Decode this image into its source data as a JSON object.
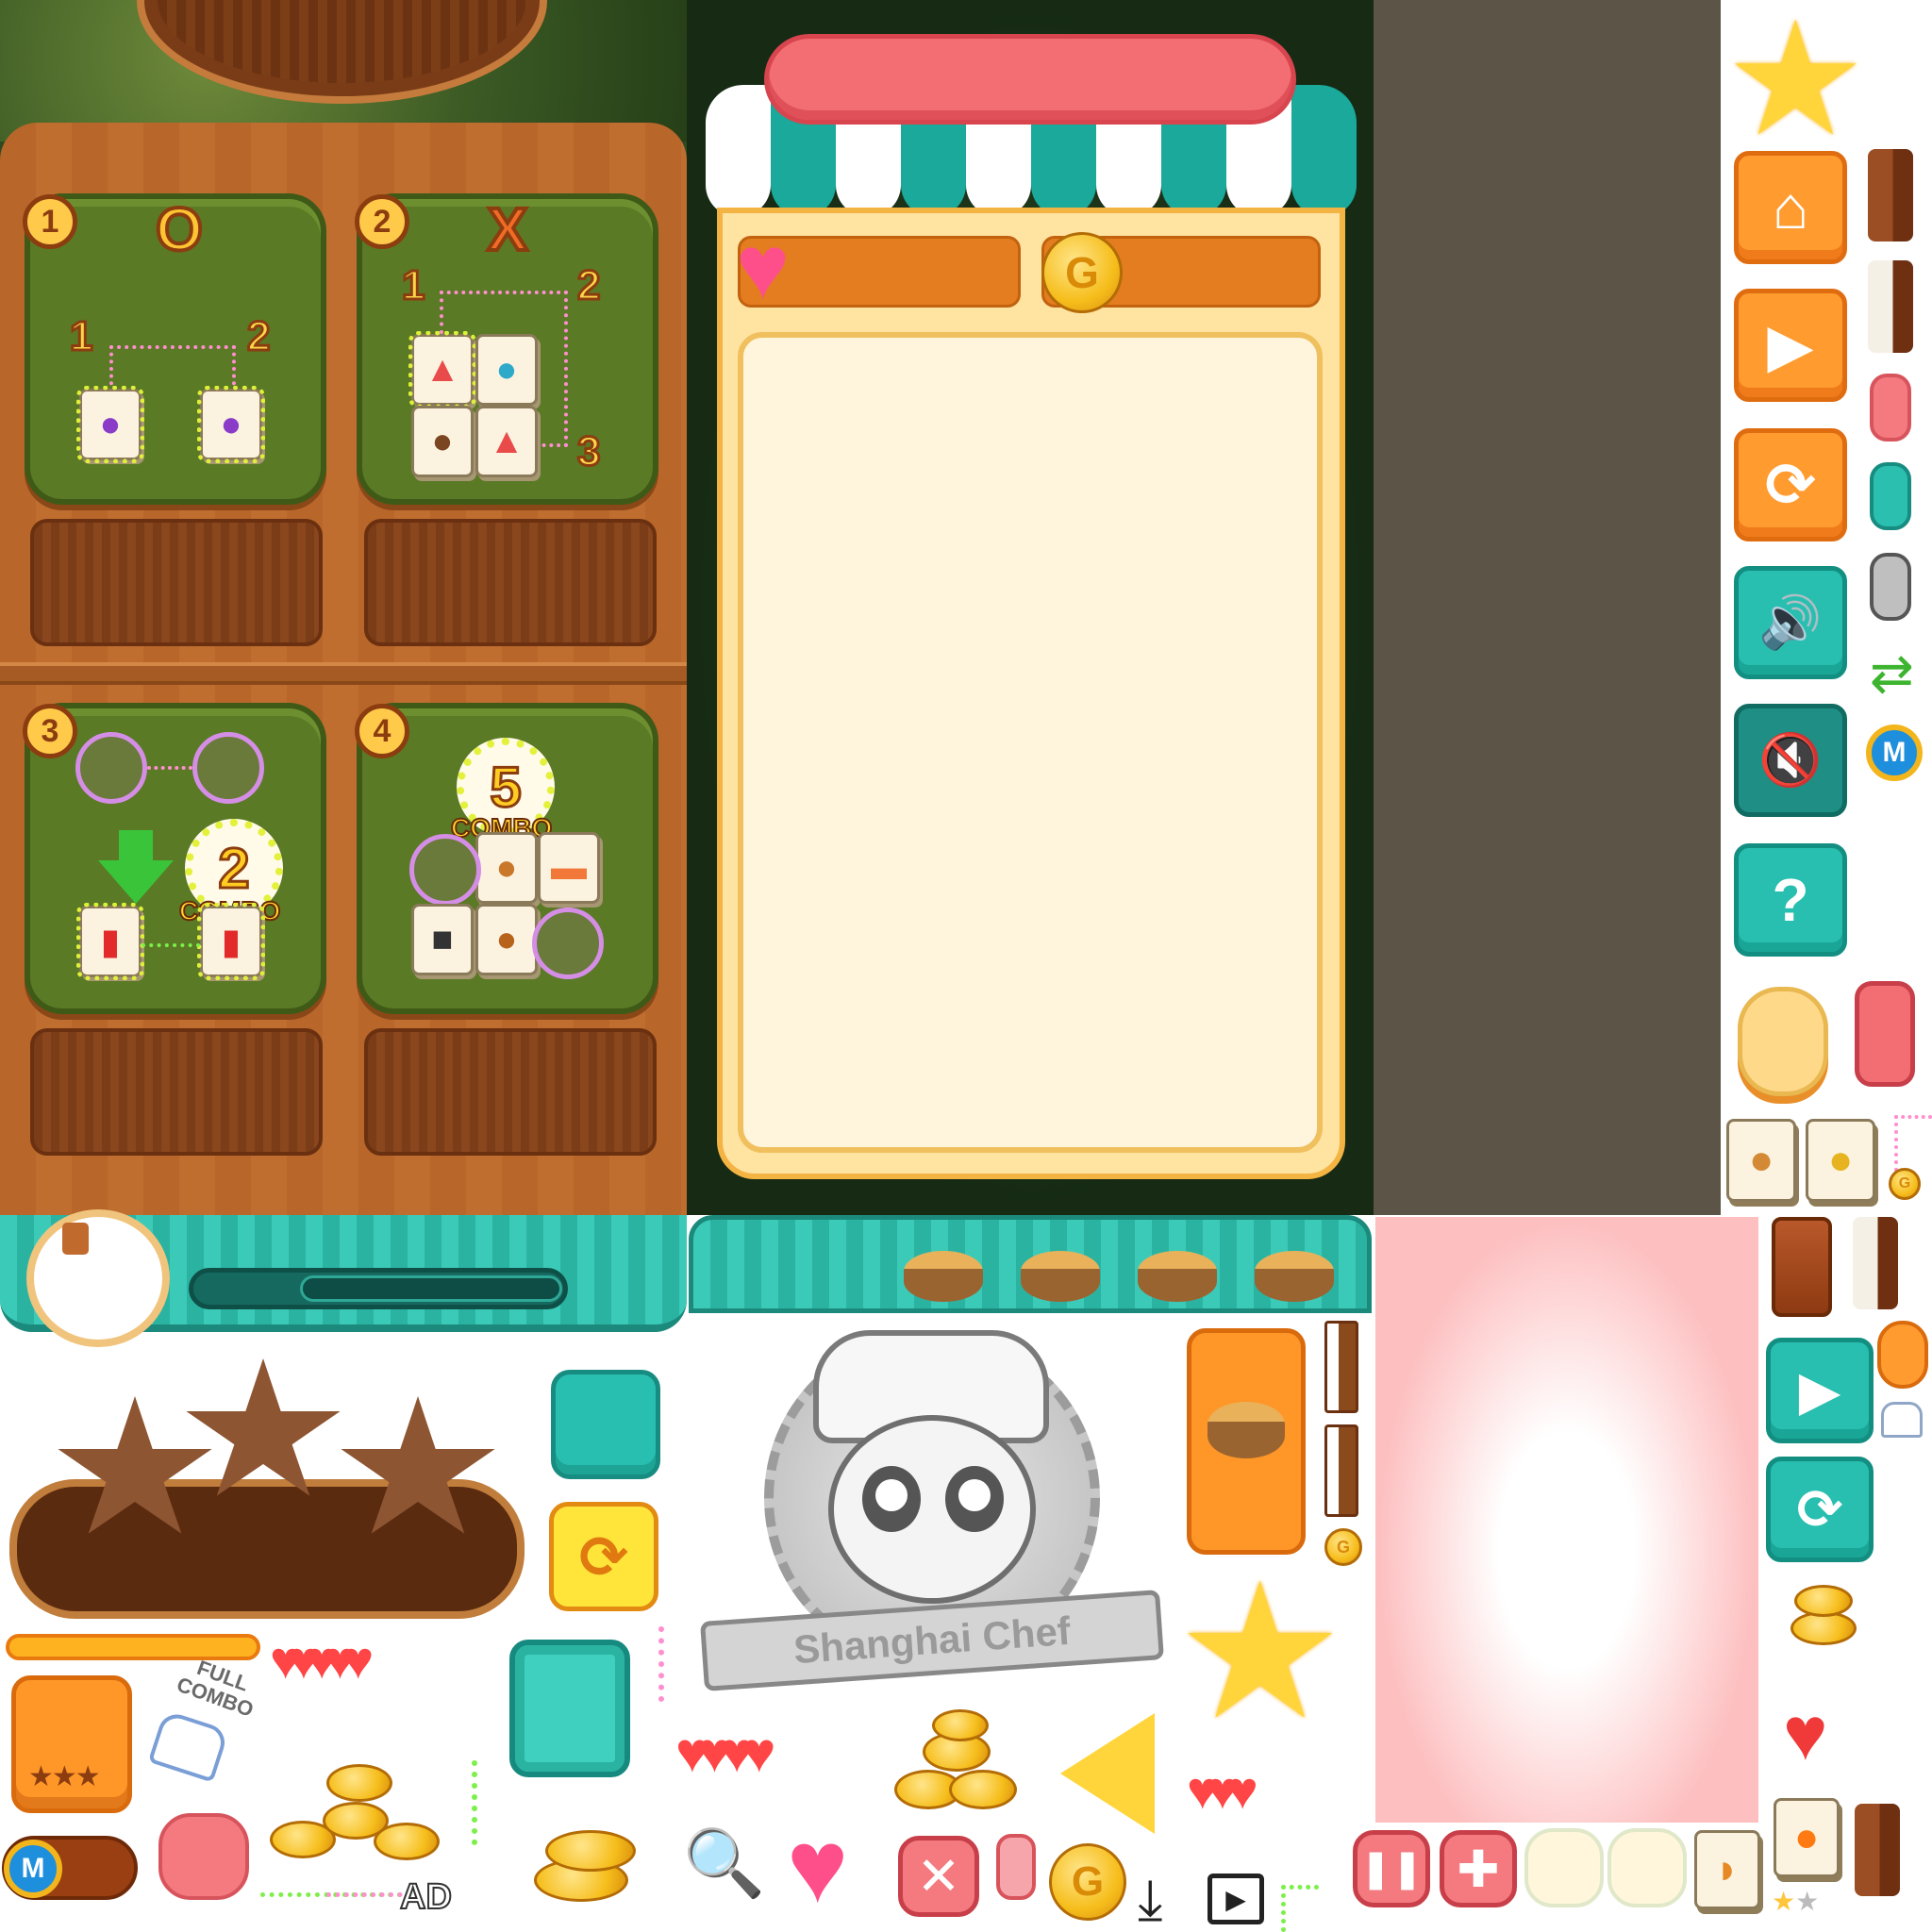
{
  "tutorial": {
    "steps": [
      {
        "badge": "1",
        "mark": "O",
        "labels": [
          "1",
          "2"
        ]
      },
      {
        "badge": "2",
        "mark": "X",
        "labels": [
          "1",
          "2",
          "3"
        ]
      },
      {
        "badge": "3",
        "combo_number": "2",
        "combo_label": "COMBO"
      },
      {
        "badge": "4",
        "combo_number": "5",
        "combo_label": "COMBO"
      }
    ]
  },
  "shop": {
    "heart_icon": "heart-icon",
    "coin_letter": "G"
  },
  "buttons": {
    "home_icon": "home-icon",
    "play_icon": "play-icon",
    "retry_icon": "refresh-icon",
    "sound_on_icon": "speaker-on-icon",
    "sound_off_icon": "speaker-mute-icon",
    "help_label": "?",
    "m_badge": "M"
  },
  "bottom_left": {
    "full_combo": "FULL COMBO",
    "ad_label": "AD",
    "m_badge": "M"
  },
  "logo": {
    "title": "Shanghai Chef"
  },
  "colors": {
    "teal": "#28bfb0",
    "orange": "#ff9b2f",
    "pink": "#f26e72",
    "wood": "#b8662a",
    "gold": "#f6be1c"
  }
}
